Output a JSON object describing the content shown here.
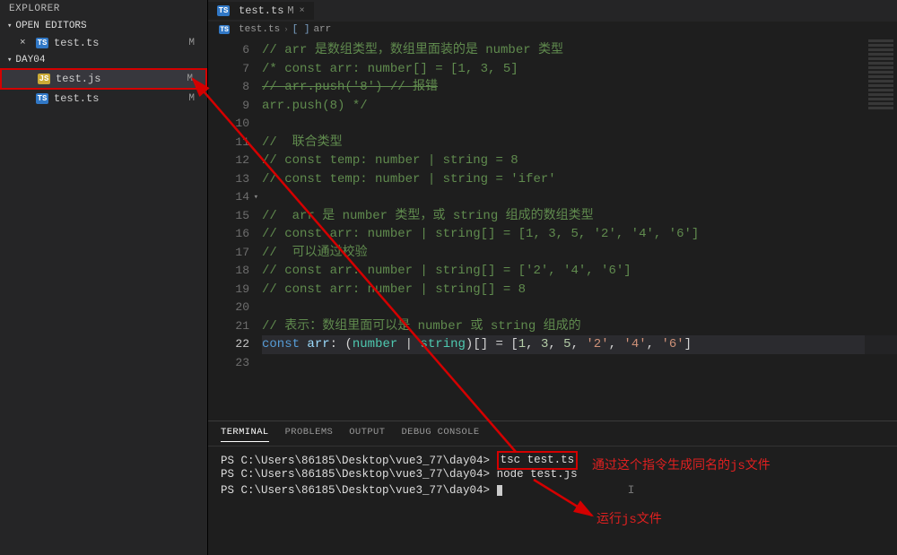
{
  "sidebar": {
    "title": "EXPLORER",
    "groups": [
      {
        "label": "OPEN EDITORS",
        "items": [
          {
            "icon": "ts",
            "name": "test.ts",
            "status": "M",
            "closable": true
          }
        ]
      },
      {
        "label": "DAY04",
        "items": [
          {
            "icon": "js",
            "name": "test.js",
            "status": "M",
            "highlight": true
          },
          {
            "icon": "ts",
            "name": "test.ts",
            "status": "M"
          }
        ]
      }
    ]
  },
  "tab": {
    "icon": "ts",
    "name": "test.ts",
    "status": "M"
  },
  "breadcrumb": {
    "icon": "ts",
    "file": "test.ts",
    "sym_icon": "[ ]",
    "symbol": "arr"
  },
  "code": {
    "start": 6,
    "lines": [
      {
        "n": 6,
        "tokens": [
          [
            "cm",
            "// "
          ],
          [
            "cm",
            "arr 是数组类型，数组里面装的是 number 类型"
          ]
        ]
      },
      {
        "n": 7,
        "tokens": [
          [
            "cm",
            "/* const arr: number[] = [1, 3, 5]"
          ]
        ]
      },
      {
        "n": 8,
        "tokens": [
          [
            "struck",
            "// arr.push('8') // 报错"
          ]
        ]
      },
      {
        "n": 9,
        "tokens": [
          [
            "cm",
            "arr.push(8) */"
          ]
        ]
      },
      {
        "n": 10,
        "tokens": [
          [
            "op",
            ""
          ]
        ]
      },
      {
        "n": 11,
        "tokens": [
          [
            "cm",
            "//  联合类型"
          ]
        ]
      },
      {
        "n": 12,
        "tokens": [
          [
            "cm",
            "// const temp: number | string = 8"
          ]
        ]
      },
      {
        "n": 13,
        "tokens": [
          [
            "cm",
            "// const temp: number | string = 'ifer'"
          ]
        ]
      },
      {
        "n": 14,
        "tokens": [
          [
            "op",
            ""
          ]
        ],
        "fold": true
      },
      {
        "n": 15,
        "tokens": [
          [
            "cm",
            "//  arr 是 number 类型，或 string 组成的数组类型"
          ]
        ]
      },
      {
        "n": 16,
        "tokens": [
          [
            "cm",
            "// const arr: number | string[] = [1, 3, 5, '2', '4', '6']"
          ]
        ]
      },
      {
        "n": 17,
        "tokens": [
          [
            "cm",
            "//  可以通过校验"
          ]
        ]
      },
      {
        "n": 18,
        "tokens": [
          [
            "cm",
            "// const arr: number | string[] = ['2', '4', '6']"
          ]
        ]
      },
      {
        "n": 19,
        "tokens": [
          [
            "cm",
            "// const arr: number | string[] = 8"
          ]
        ]
      },
      {
        "n": 20,
        "tokens": [
          [
            "op",
            ""
          ]
        ]
      },
      {
        "n": 21,
        "tokens": [
          [
            "cm",
            "// 表示：数组里面可以是 number 或 string 组成的"
          ]
        ]
      },
      {
        "n": 22,
        "hl": true,
        "tokens": [
          [
            "kw",
            "const"
          ],
          [
            "op",
            " "
          ],
          [
            "id",
            "arr"
          ],
          [
            "op",
            ": ("
          ],
          [
            "ty",
            "number"
          ],
          [
            "op",
            " | "
          ],
          [
            "ty",
            "string"
          ],
          [
            "op",
            ")[] = ["
          ],
          [
            "num",
            "1"
          ],
          [
            "op",
            ", "
          ],
          [
            "num",
            "3"
          ],
          [
            "op",
            ", "
          ],
          [
            "num",
            "5"
          ],
          [
            "op",
            ", "
          ],
          [
            "str",
            "'2'"
          ],
          [
            "op",
            ", "
          ],
          [
            "str",
            "'4'"
          ],
          [
            "op",
            ", "
          ],
          [
            "str",
            "'6'"
          ],
          [
            "op",
            "]"
          ]
        ]
      },
      {
        "n": 23,
        "tokens": [
          [
            "op",
            ""
          ]
        ]
      }
    ]
  },
  "panel": {
    "tabs": [
      "TERMINAL",
      "PROBLEMS",
      "OUTPUT",
      "DEBUG CONSOLE"
    ],
    "active": 0,
    "prompt": "PS C:\\Users\\86185\\Desktop\\vue3_77\\day04>",
    "lines": [
      {
        "cmd": "tsc test.ts",
        "boxed": true
      },
      {
        "cmd": "node test.js"
      },
      {
        "cmd": ""
      }
    ]
  },
  "annotations": {
    "a1": "通过这个指令生成同名的js文件",
    "a2": "运行js文件"
  }
}
